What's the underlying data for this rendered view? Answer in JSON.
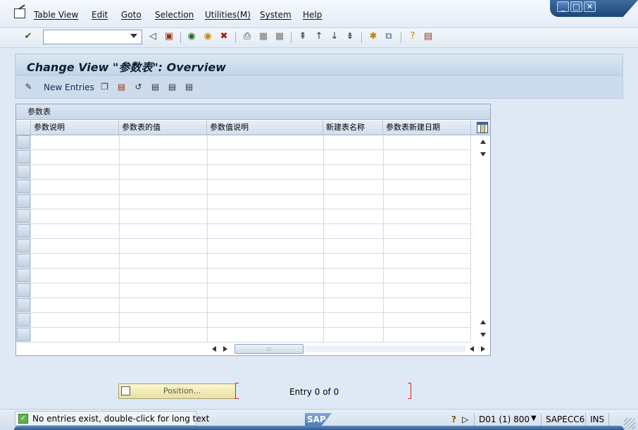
{
  "menu": {
    "items": [
      {
        "label": "Table View"
      },
      {
        "label": "Edit"
      },
      {
        "label": "Goto"
      },
      {
        "label": "Selection"
      },
      {
        "label": "Utilities(M)"
      },
      {
        "label": "System"
      },
      {
        "label": "Help"
      }
    ]
  },
  "window_controls": {
    "minimize": "_",
    "maximize": "□",
    "close": "✕"
  },
  "toolbar": {
    "command_field_value": ""
  },
  "title": {
    "text": "Change View \"参数表\": Overview"
  },
  "app_toolbar": {
    "new_entries_label": "New Entries"
  },
  "table": {
    "caption": "参数表",
    "columns": [
      "参数说明",
      "参数表的值",
      "参数值说明",
      "新建表名称",
      "参数表新建日期"
    ],
    "rows": []
  },
  "position": {
    "label": "Position..."
  },
  "entry": {
    "text": "Entry 0 of 0"
  },
  "status": {
    "message": "No entries exist, double-click for long text",
    "system": "D01 (1) 800",
    "server": "SAPECC6",
    "mode": "INS",
    "logo": "SAP"
  },
  "colors": {
    "background": "#dfe9f5",
    "title_band": "#c3d5e9",
    "window_controls": "#1e4577",
    "position_button": "#eadf9e",
    "bracket": "#d0202a"
  }
}
